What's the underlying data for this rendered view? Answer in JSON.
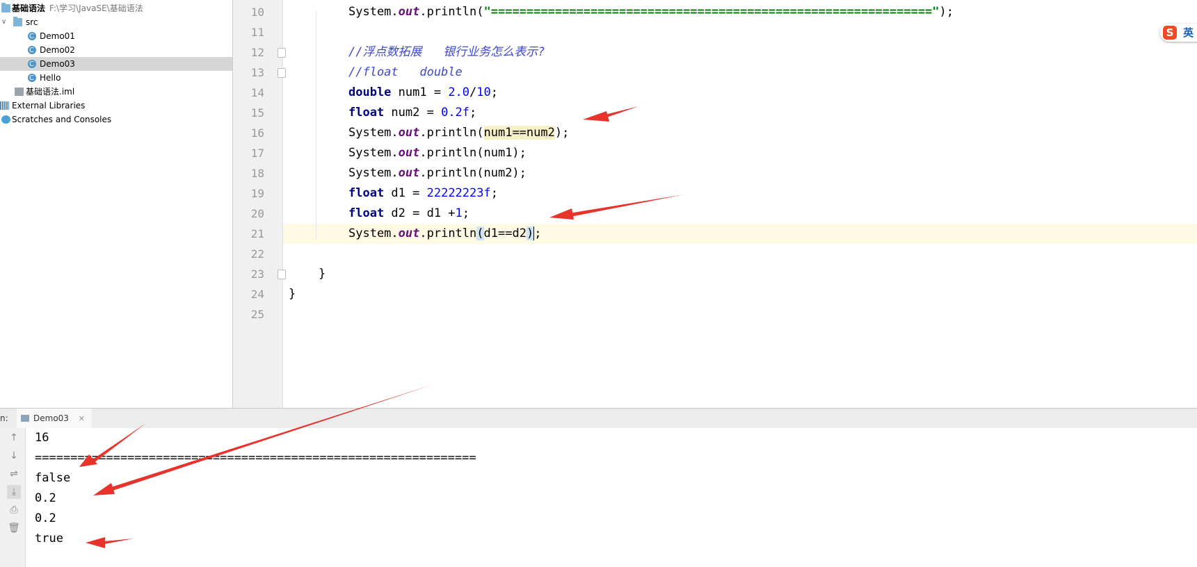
{
  "project": {
    "root_name": "基础语法",
    "root_path": "F:\\学习\\JavaSE\\基础语法",
    "src_label": "src",
    "files": [
      "Demo01",
      "Demo02",
      "Demo03",
      "Hello"
    ],
    "selected_file": "Demo03",
    "iml_label": "基础语法.iml",
    "external_libraries": "External Libraries",
    "scratches": "Scratches and Consoles"
  },
  "editor": {
    "line_numbers": [
      "10",
      "11",
      "12",
      "13",
      "14",
      "15",
      "16",
      "17",
      "18",
      "19",
      "20",
      "21",
      "22",
      "23",
      "24",
      "25"
    ],
    "line10": {
      "a": "System.",
      "b": "out",
      "c": ".println(",
      "d": "\"==============================================================\"",
      "e": ");"
    },
    "line12": "//浮点数拓展   银行业务怎么表示?",
    "line13": "//float   double",
    "line14": {
      "kw": "double",
      "a": " num1 = ",
      "n1": "2.0",
      "s": "/",
      "n2": "10",
      "e": ";"
    },
    "line15": {
      "kw": "float",
      "a": " num2 = ",
      "n1": "0.2f",
      "e": ";"
    },
    "line16": {
      "a": "System.",
      "b": "out",
      "c": ".println(",
      "h": "num1==num2",
      "e": ");"
    },
    "line17": {
      "a": "System.",
      "b": "out",
      "c": ".println(num1);"
    },
    "line18": {
      "a": "System.",
      "b": "out",
      "c": ".println(num2);"
    },
    "line19": {
      "kw": "float",
      "a": " d1 = ",
      "n1": "22222223f",
      "e": ";"
    },
    "line20": {
      "kw": "float",
      "a": " d2 = d1 +",
      "n1": "1",
      "e": ";"
    },
    "line21": {
      "a": "System.",
      "b": "out",
      "c": ".println",
      "p1": "(",
      "m": "d1==d2",
      "p2": ")",
      "e": ";"
    },
    "line23": "}",
    "line24": "}"
  },
  "ime": {
    "logo": "S",
    "mode": "英"
  },
  "run": {
    "label": "n:",
    "tab_name": "Demo03",
    "tab_close": "✕",
    "output": [
      "16",
      "==============================================================",
      "false",
      "0.2",
      "0.2",
      "true"
    ]
  },
  "colors": {
    "annotation_arrow": "#e8322c",
    "keyword": "#000080",
    "number": "#0000ff",
    "string": "#008000",
    "field": "#660e7a"
  }
}
